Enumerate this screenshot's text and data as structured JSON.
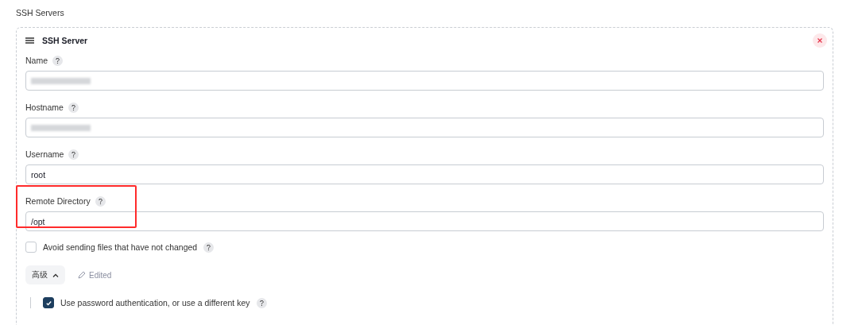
{
  "section_title": "SSH Servers",
  "server": {
    "title": "SSH Server",
    "fields": [
      {
        "label": "Name",
        "kind": "redacted",
        "highlighted": false
      },
      {
        "label": "Hostname",
        "kind": "redacted",
        "highlighted": false
      },
      {
        "label": "Username",
        "kind": "text",
        "value": "root",
        "highlighted": false
      },
      {
        "label": "Remote Directory",
        "kind": "text",
        "value": "/opt",
        "highlighted": true
      }
    ],
    "avoid_unchanged": {
      "label": "Avoid sending files that have not changed",
      "checked": false
    },
    "advanced": {
      "label": "高级",
      "expanded": true,
      "edited_label": "Edited"
    },
    "password_auth": {
      "label": "Use password authentication, or use a different key",
      "checked": true
    }
  }
}
